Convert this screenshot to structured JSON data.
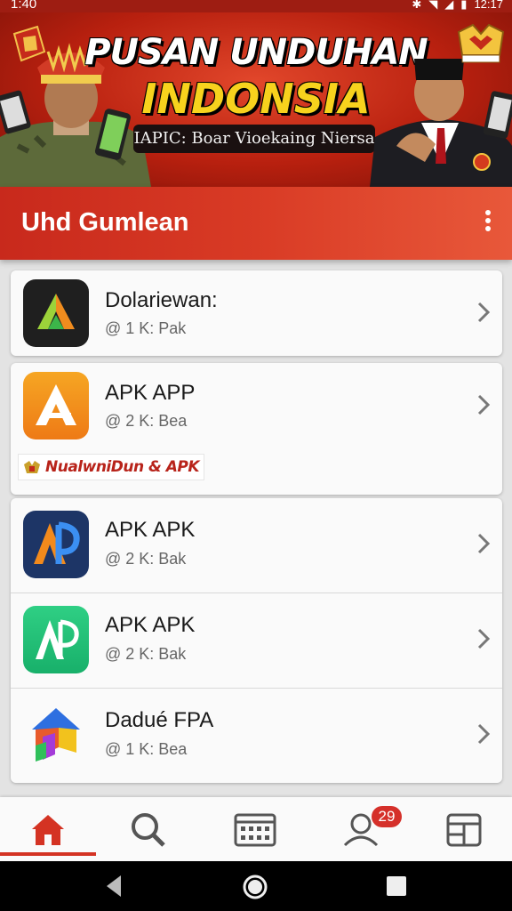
{
  "status_bar": {
    "time": "1:40",
    "right_time": "12:17"
  },
  "banner": {
    "title_line1": "PUSAN UNDUHAN",
    "title_line2": "INDONSIA",
    "subtitle": "IAPIC: Boar Vioekaing Niersa"
  },
  "header": {
    "title": "Uhd Gumlean"
  },
  "apps": [
    {
      "name": "Dolariewan:",
      "meta": "@ 1  K: Pak",
      "icon": "dark-triangle-app-icon"
    },
    {
      "name": "APK APP",
      "meta": "@ 2  K: Bea",
      "icon": "orange-a-app-icon",
      "promo": "NualwniDun & APK"
    },
    {
      "name": "APK APK",
      "meta": "@ 2  K: Bak",
      "icon": "blue-ap-app-icon"
    },
    {
      "name": "APK APK",
      "meta": "@ 2  K: Bak",
      "icon": "green-ap-app-icon"
    },
    {
      "name": "Dadué FPA",
      "meta": "@ 1  K: Bea",
      "icon": "colorful-house-app-icon"
    }
  ],
  "bottom_nav": {
    "items": [
      "home",
      "search",
      "calendar",
      "profile",
      "storage"
    ],
    "active": "home",
    "badge_count": "29"
  },
  "colors": {
    "accent": "#d43323",
    "header": "#d93b25",
    "banner": "#c22b17"
  }
}
